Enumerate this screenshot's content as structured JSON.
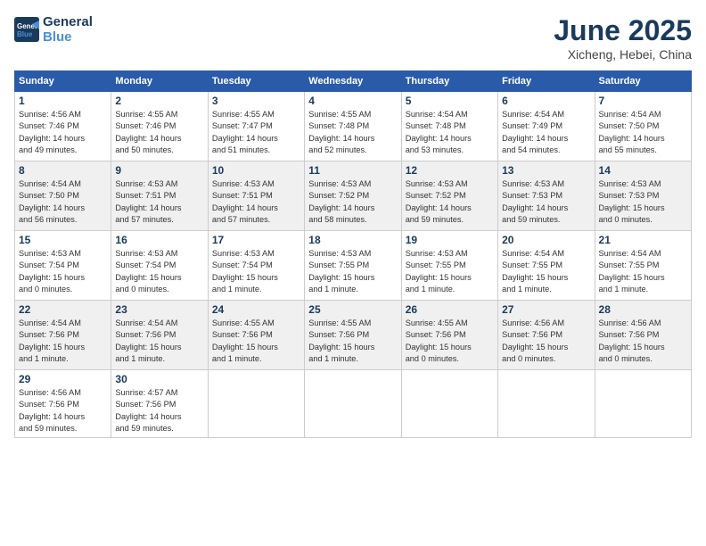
{
  "header": {
    "logo_line1": "General",
    "logo_line2": "Blue",
    "month": "June 2025",
    "location": "Xicheng, Hebei, China"
  },
  "weekdays": [
    "Sunday",
    "Monday",
    "Tuesday",
    "Wednesday",
    "Thursday",
    "Friday",
    "Saturday"
  ],
  "weeks": [
    [
      {
        "day": "1",
        "info": "Sunrise: 4:56 AM\nSunset: 7:46 PM\nDaylight: 14 hours\nand 49 minutes."
      },
      {
        "day": "2",
        "info": "Sunrise: 4:55 AM\nSunset: 7:46 PM\nDaylight: 14 hours\nand 50 minutes."
      },
      {
        "day": "3",
        "info": "Sunrise: 4:55 AM\nSunset: 7:47 PM\nDaylight: 14 hours\nand 51 minutes."
      },
      {
        "day": "4",
        "info": "Sunrise: 4:55 AM\nSunset: 7:48 PM\nDaylight: 14 hours\nand 52 minutes."
      },
      {
        "day": "5",
        "info": "Sunrise: 4:54 AM\nSunset: 7:48 PM\nDaylight: 14 hours\nand 53 minutes."
      },
      {
        "day": "6",
        "info": "Sunrise: 4:54 AM\nSunset: 7:49 PM\nDaylight: 14 hours\nand 54 minutes."
      },
      {
        "day": "7",
        "info": "Sunrise: 4:54 AM\nSunset: 7:50 PM\nDaylight: 14 hours\nand 55 minutes."
      }
    ],
    [
      {
        "day": "8",
        "info": "Sunrise: 4:54 AM\nSunset: 7:50 PM\nDaylight: 14 hours\nand 56 minutes."
      },
      {
        "day": "9",
        "info": "Sunrise: 4:53 AM\nSunset: 7:51 PM\nDaylight: 14 hours\nand 57 minutes."
      },
      {
        "day": "10",
        "info": "Sunrise: 4:53 AM\nSunset: 7:51 PM\nDaylight: 14 hours\nand 57 minutes."
      },
      {
        "day": "11",
        "info": "Sunrise: 4:53 AM\nSunset: 7:52 PM\nDaylight: 14 hours\nand 58 minutes."
      },
      {
        "day": "12",
        "info": "Sunrise: 4:53 AM\nSunset: 7:52 PM\nDaylight: 14 hours\nand 59 minutes."
      },
      {
        "day": "13",
        "info": "Sunrise: 4:53 AM\nSunset: 7:53 PM\nDaylight: 14 hours\nand 59 minutes."
      },
      {
        "day": "14",
        "info": "Sunrise: 4:53 AM\nSunset: 7:53 PM\nDaylight: 15 hours\nand 0 minutes."
      }
    ],
    [
      {
        "day": "15",
        "info": "Sunrise: 4:53 AM\nSunset: 7:54 PM\nDaylight: 15 hours\nand 0 minutes."
      },
      {
        "day": "16",
        "info": "Sunrise: 4:53 AM\nSunset: 7:54 PM\nDaylight: 15 hours\nand 0 minutes."
      },
      {
        "day": "17",
        "info": "Sunrise: 4:53 AM\nSunset: 7:54 PM\nDaylight: 15 hours\nand 1 minute."
      },
      {
        "day": "18",
        "info": "Sunrise: 4:53 AM\nSunset: 7:55 PM\nDaylight: 15 hours\nand 1 minute."
      },
      {
        "day": "19",
        "info": "Sunrise: 4:53 AM\nSunset: 7:55 PM\nDaylight: 15 hours\nand 1 minute."
      },
      {
        "day": "20",
        "info": "Sunrise: 4:54 AM\nSunset: 7:55 PM\nDaylight: 15 hours\nand 1 minute."
      },
      {
        "day": "21",
        "info": "Sunrise: 4:54 AM\nSunset: 7:55 PM\nDaylight: 15 hours\nand 1 minute."
      }
    ],
    [
      {
        "day": "22",
        "info": "Sunrise: 4:54 AM\nSunset: 7:56 PM\nDaylight: 15 hours\nand 1 minute."
      },
      {
        "day": "23",
        "info": "Sunrise: 4:54 AM\nSunset: 7:56 PM\nDaylight: 15 hours\nand 1 minute."
      },
      {
        "day": "24",
        "info": "Sunrise: 4:55 AM\nSunset: 7:56 PM\nDaylight: 15 hours\nand 1 minute."
      },
      {
        "day": "25",
        "info": "Sunrise: 4:55 AM\nSunset: 7:56 PM\nDaylight: 15 hours\nand 1 minute."
      },
      {
        "day": "26",
        "info": "Sunrise: 4:55 AM\nSunset: 7:56 PM\nDaylight: 15 hours\nand 0 minutes."
      },
      {
        "day": "27",
        "info": "Sunrise: 4:56 AM\nSunset: 7:56 PM\nDaylight: 15 hours\nand 0 minutes."
      },
      {
        "day": "28",
        "info": "Sunrise: 4:56 AM\nSunset: 7:56 PM\nDaylight: 15 hours\nand 0 minutes."
      }
    ],
    [
      {
        "day": "29",
        "info": "Sunrise: 4:56 AM\nSunset: 7:56 PM\nDaylight: 14 hours\nand 59 minutes."
      },
      {
        "day": "30",
        "info": "Sunrise: 4:57 AM\nSunset: 7:56 PM\nDaylight: 14 hours\nand 59 minutes."
      },
      {
        "day": "",
        "info": ""
      },
      {
        "day": "",
        "info": ""
      },
      {
        "day": "",
        "info": ""
      },
      {
        "day": "",
        "info": ""
      },
      {
        "day": "",
        "info": ""
      }
    ]
  ]
}
